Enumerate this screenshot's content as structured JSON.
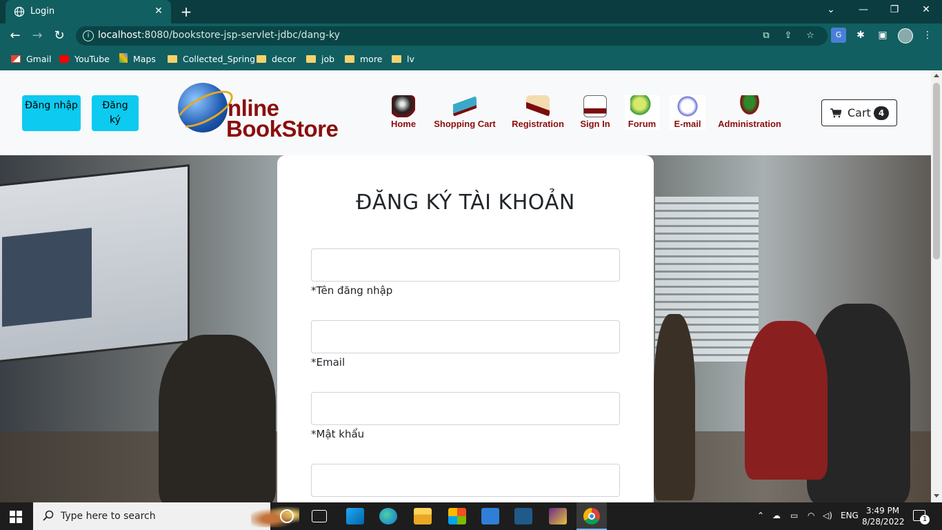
{
  "browser": {
    "tab_title": "Login",
    "url_host": "localhost",
    "url_rest": ":8080/bookstore-jsp-servlet-jdbc/dang-ky",
    "bookmarks": [
      "Gmail",
      "YouTube",
      "Maps",
      "Collected_Spring",
      "decor",
      "job",
      "more",
      "lv"
    ]
  },
  "header": {
    "login_button": "Đăng nhập",
    "register_button": "Đăng ký",
    "logo_line1": "nline",
    "logo_line2": "BookStore",
    "nav": [
      "Home",
      "Shopping Cart",
      "Registration",
      "Sign In",
      "Forum",
      "E-mail",
      "Administration"
    ],
    "cart_label": "Cart",
    "cart_count": "4"
  },
  "form": {
    "title": "ĐĂNG KÝ TÀI KHOẢN",
    "fields": [
      {
        "label": "*Tên đăng nhập",
        "value": ""
      },
      {
        "label": "*Email",
        "value": ""
      },
      {
        "label": "*Mật khẩu",
        "value": ""
      },
      {
        "label": "",
        "value": ""
      }
    ]
  },
  "taskbar": {
    "search_placeholder": "Type here to search",
    "language": "ENG",
    "time": "3:49 PM",
    "date": "8/28/2022",
    "notification_count": "1"
  },
  "colors": {
    "chrome_dark": "#0b3c3f",
    "chrome": "#115f61",
    "cyan_button": "#0dcaf0",
    "logo_red": "#8b0e0e"
  }
}
